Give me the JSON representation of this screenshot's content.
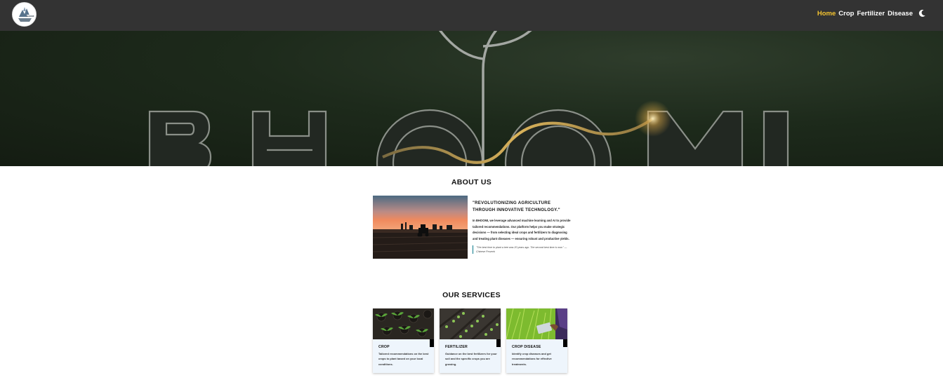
{
  "header": {
    "logo_icon": "bhoomi-logo-icon",
    "logo_text": "BHOOMI",
    "nav": [
      {
        "label": "Home",
        "active": true
      },
      {
        "label": "Crop",
        "active": false
      },
      {
        "label": "Fertilizer",
        "active": false
      },
      {
        "label": "Disease",
        "active": false
      }
    ],
    "theme_toggle_icon": "moon-icon",
    "accent_color": "#f4c430",
    "bar_color": "#333333"
  },
  "hero": {
    "wordmark": "BHOOMI",
    "background_color": "#1d2a1b"
  },
  "about": {
    "title": "ABOUT US",
    "image_icon": "tractor-sunset-photo",
    "headline": "\"REVOLUTIONIZING AGRICULTURE THROUGH INNOVATIVE TECHNOLOGY.\"",
    "body": "In BHOOMI, we leverage advanced machine learning and AI to provide tailored recommendations. Our platform helps you make strategic decisions — from selecting ideal crops and fertilizers to diagnosing and treating plant diseases — ensuring robust and productive yields.",
    "quote": "\"The best time to plant a tree was 20 years ago. The second best time is now.\" — Chinese Proverb",
    "quote_border_color": "#0b7a8a"
  },
  "services": {
    "title": "OUR SERVICES",
    "cards": [
      {
        "title": "CROP",
        "description": "Tailored recommendations on the best crops to plant based on your local conditions.",
        "image_icon": "seedlings-photo"
      },
      {
        "title": "FERTILIZER",
        "description": "Guidance on the best fertilizers for your soil and the specific crops you are growing.",
        "image_icon": "soil-sprouts-photo"
      },
      {
        "title": "CROP DISEASE",
        "description": "Identify crop diseases and get recommendations for effective treatments.",
        "image_icon": "field-tablet-photo"
      }
    ]
  }
}
